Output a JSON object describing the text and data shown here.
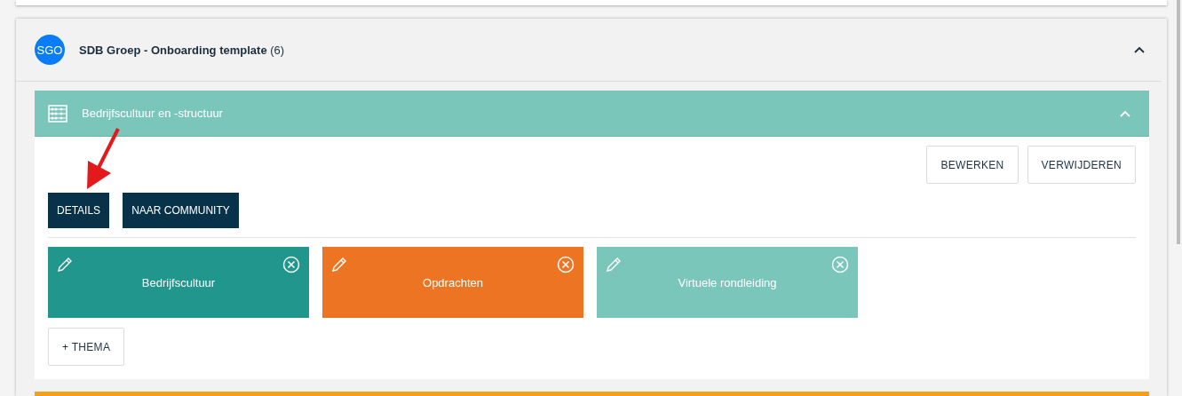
{
  "group": {
    "avatar": "SGO",
    "title": "SDB Groep - Onboarding template",
    "count": "(6)",
    "expanded": true,
    "section": {
      "title": "Bedrijfscultuur en -structuur",
      "expanded": true,
      "actions": [
        "BEWERKEN",
        "VERWIJDEREN"
      ],
      "links": [
        "DETAILS",
        "NAAR COMMUNITY"
      ],
      "themes": [
        {
          "title": "Bedrijfscultuur",
          "color": "#21968c"
        },
        {
          "title": "Opdrachten",
          "color": "#ed7422"
        },
        {
          "title": "Virtuele rondleiding",
          "color": "#7bc6bb"
        }
      ],
      "add_button": "+ THEMA"
    }
  },
  "annotation": {
    "kind": "arrow"
  }
}
